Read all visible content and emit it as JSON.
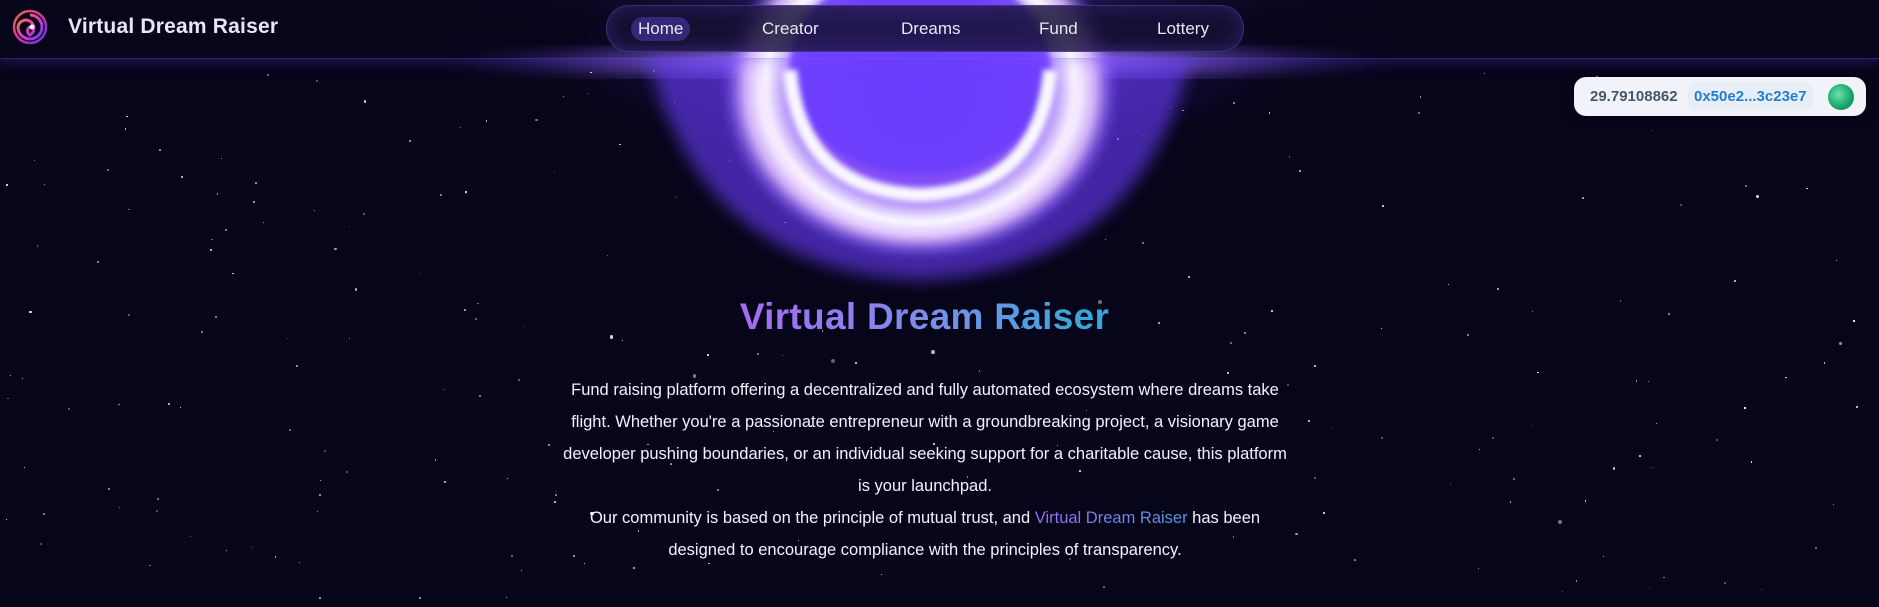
{
  "header": {
    "brand": "Virtual Dream Raiser",
    "logo_icon": "spiral-logo-icon",
    "nav": [
      {
        "label": "Home",
        "active": true
      },
      {
        "label": "Creator",
        "active": false
      },
      {
        "label": "Dreams",
        "active": false
      },
      {
        "label": "Fund",
        "active": false
      },
      {
        "label": "Lottery",
        "active": false
      }
    ]
  },
  "wallet": {
    "balance": "29.79108862",
    "address": "0x50e2...3c23e7",
    "avatar_icon": "wallet-avatar-icon"
  },
  "hero": {
    "title": "Virtual Dream Raiser",
    "paragraph1": "Fund raising platform offering a decentralized and fully automated ecosystem where dreams take flight. Whether you're a passionate entrepreneur with a groundbreaking project, a visionary game developer pushing boundaries, or an individual seeking support for a charitable cause, this platform is your launchpad.",
    "paragraph2_before": "Our community is based on the principle of mutual trust, and ",
    "paragraph2_highlight": "Virtual Dream Raiser",
    "paragraph2_after": " has been designed to encourage compliance with the principles of transparency."
  },
  "colors": {
    "background": "#07051a",
    "accent_purple": "#a76af3",
    "accent_blue": "#32a8d8",
    "glow": "#7b4dff"
  }
}
